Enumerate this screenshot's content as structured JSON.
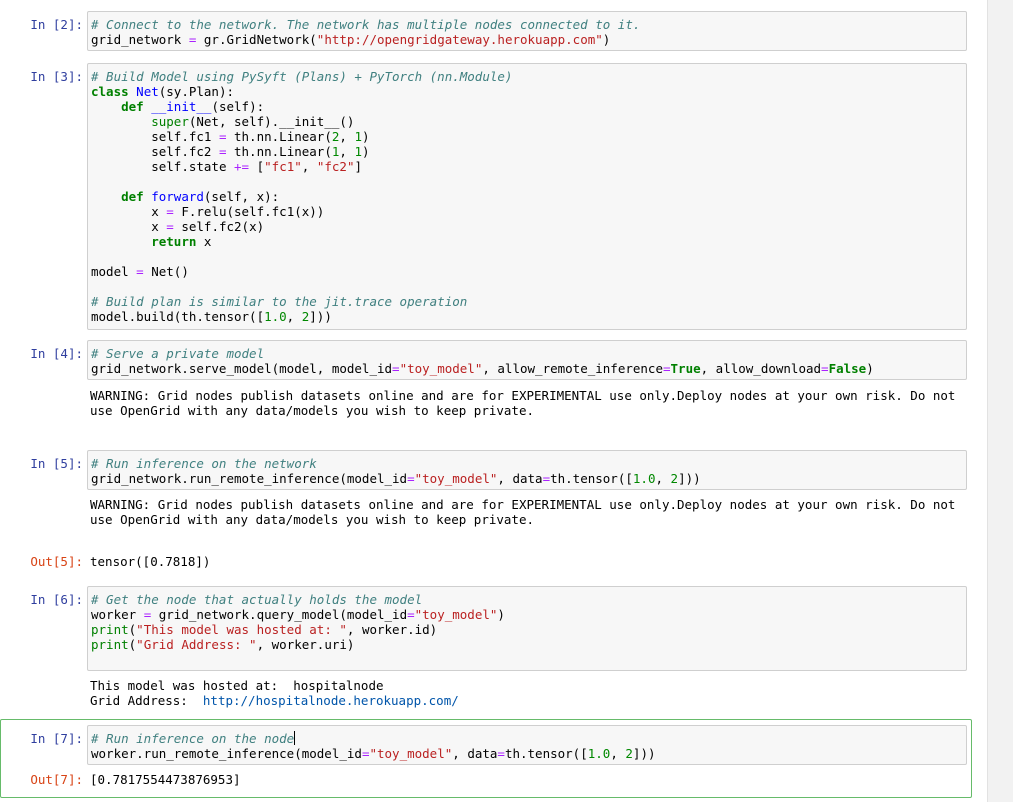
{
  "cells": {
    "c2": {
      "prompt": "In [2]:",
      "l1": "# Connect to the network. The network has multiple nodes connected to it.",
      "l2a": "grid_network ",
      "l2eq": "=",
      "l2b": " gr.GridNetwork(",
      "l2s": "\"http://opengridgateway.herokuapp.com\"",
      "l2c": ")"
    },
    "c3": {
      "prompt": "In [3]:",
      "comment1": "# Build Model using PySyft (Plans) + PyTorch (nn.Module)",
      "class_kw": "class",
      "class_name": "Net",
      "class_rest": "(sy.Plan):",
      "def_kw": "def",
      "init_name": "__init__",
      "init_rest": "(self):",
      "super_kw": "super",
      "super_rest": "(Net, self).__init__()",
      "fc1_a": "self.fc1 ",
      "fc1_b": " th.nn.Linear(",
      "fc1_n1": "2",
      "fc1_n2": "1",
      "fc2_a": "self.fc2 ",
      "fc2_b": " th.nn.Linear(",
      "fc2_n1": "1",
      "fc2_n2": "1",
      "state_a": "self.state ",
      "state_op": "+=",
      "state_s1": "\"fc1\"",
      "state_s2": "\"fc2\"",
      "forward_name": "forward",
      "forward_rest": "(self, x):",
      "relu_a": "x ",
      "relu_b": " F.relu(self.fc1(x))",
      "fc2call_a": "x ",
      "fc2call_b": " self.fc2(x)",
      "return_kw": "return",
      "return_rest": " x",
      "model_a": "model ",
      "model_b": " Net()",
      "comment2": "# Build plan is similar to the jit.trace operation",
      "build_a": "model.build(th.tensor([",
      "build_n1": "1.0",
      "build_n2": "2",
      "build_c": "]))"
    },
    "c4": {
      "prompt": "In [4]:",
      "comment": "# Serve a private model",
      "a": "grid_network.serve_model(model, model_id",
      "s": "\"toy_model\"",
      "b": ", allow_remote_inference",
      "t": "True",
      "c": ", allow_download",
      "f": "False",
      "d": ")",
      "warning": "WARNING: Grid nodes publish datasets online and are for EXPERIMENTAL use only.Deploy nodes at your own risk. Do not\nuse OpenGrid with any data/models you wish to keep private."
    },
    "c5": {
      "prompt": "In [5]:",
      "comment": "# Run inference on the network",
      "a": "grid_network.run_remote_inference(model_id",
      "s": "\"toy_model\"",
      "b": ", data",
      "c": "th.tensor([",
      "n1": "1.0",
      "n2": "2",
      "d": "]))",
      "warning": "WARNING: Grid nodes publish datasets online and are for EXPERIMENTAL use only.Deploy nodes at your own risk. Do not\nuse OpenGrid with any data/models you wish to keep private.",
      "out_prompt": "Out[5]:",
      "out": "tensor([0.7818])"
    },
    "c6": {
      "prompt": "In [6]:",
      "comment": "# Get the node that actually holds the model",
      "w_a": "worker ",
      "w_b": " grid_network.query_model(model_id",
      "w_s": "\"toy_model\"",
      "w_c": ")",
      "print_kw": "print",
      "p1_s": "\"This model was hosted at: \"",
      "p1_r": ", worker.id)",
      "p2_s": "\"Grid Address: \"",
      "p2_r": ", worker.uri)",
      "out1": "This model was hosted at:  hospitalnode",
      "out2_label": "Grid Address:  ",
      "out2_link": "http://hospitalnode.herokuapp.com/"
    },
    "c7": {
      "prompt": "In [7]:",
      "comment": "# Run inference on the node",
      "a": "worker.run_remote_inference(model_id",
      "s": "\"toy_model\"",
      "b": ", data",
      "c": "th.tensor([",
      "n1": "1.0",
      "n2": "2",
      "d": "]))",
      "out_prompt": "Out[7]:",
      "out": "[0.7817554473876953]"
    }
  }
}
